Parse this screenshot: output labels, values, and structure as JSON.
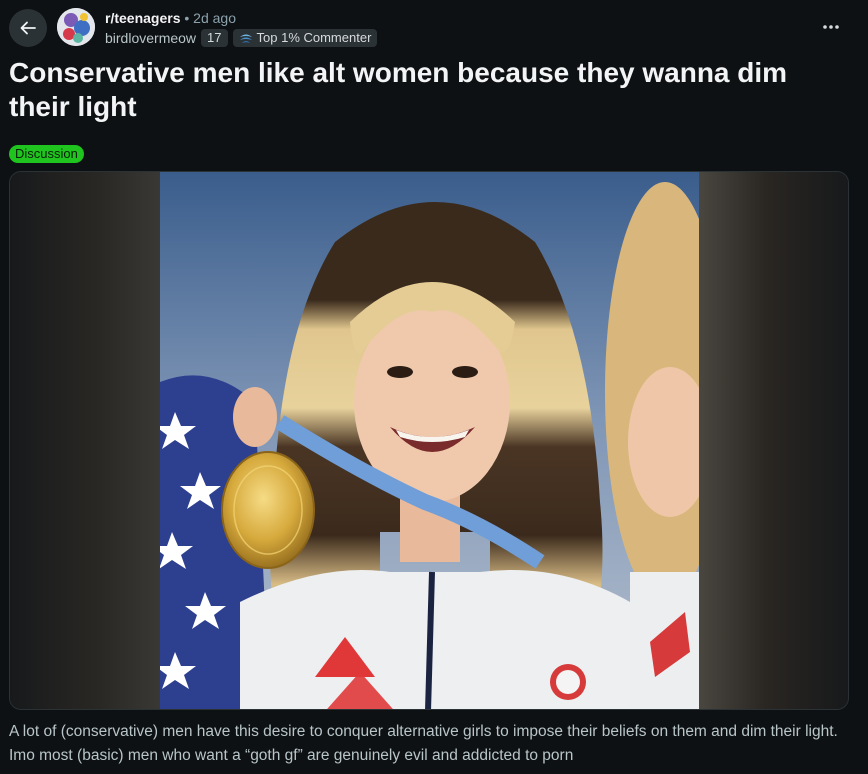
{
  "header": {
    "subreddit": "r/teenagers",
    "separator": "•",
    "time_ago": "2d ago",
    "username": "birdlovermeow",
    "karma": "17",
    "flair_label": "Top 1% Commenter",
    "icons": {
      "back": "arrow-left-icon",
      "more": "more-horizontal-icon",
      "flair": "commenter-badge-icon"
    }
  },
  "post": {
    "title": "Conservative men like alt women because they wanna dim their light",
    "tag": "Discussion",
    "tag_color": "#1fc41f",
    "body": "A lot of (conservative) men have this desire to conquer alternative girls to impose their beliefs on them and dim their light. Imo most (basic) men who want a “goth gf” are genuinely evil and addicted to porn"
  },
  "colors": {
    "background": "#0e1113",
    "text_primary": "#f2f4f5",
    "text_secondary": "#b8c5c9",
    "chip": "#2a3236"
  }
}
